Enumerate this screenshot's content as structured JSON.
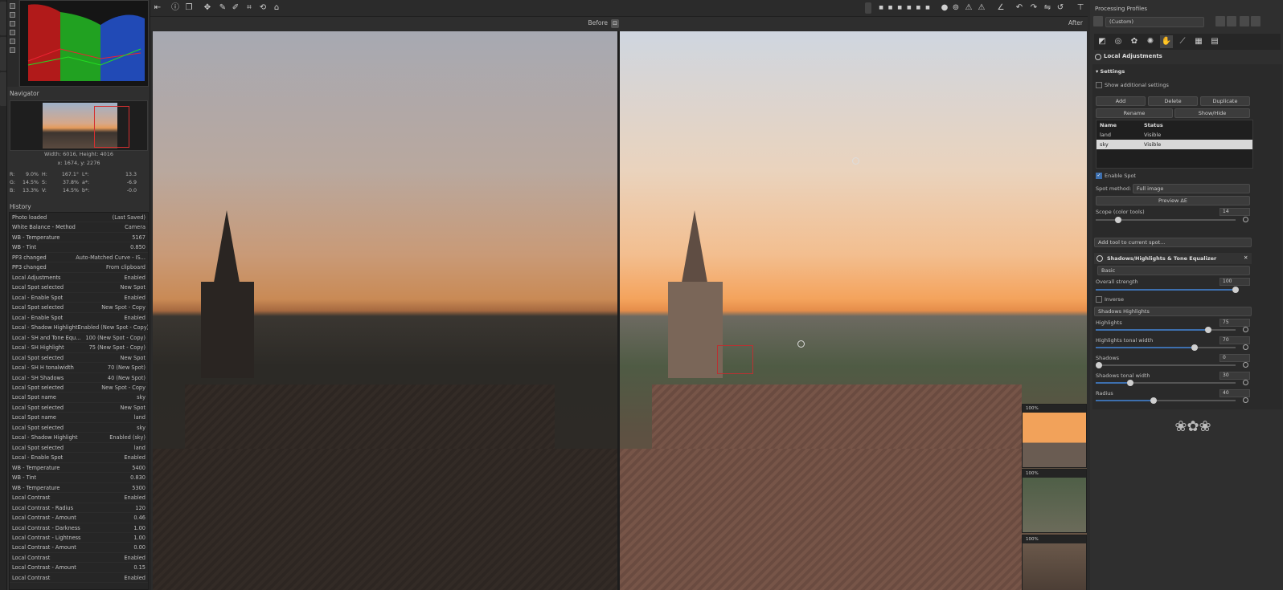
{
  "preview": {
    "before_label": "Before",
    "after_label": "After"
  },
  "detail_windows": [
    "100%",
    "100%",
    "100%"
  ],
  "navigator": {
    "title": "Navigator",
    "size": "Width: 6016, Height: 4016",
    "pos": "x: 1674, y: 2276"
  },
  "info": {
    "rows": [
      [
        "R:",
        "9.0%",
        "H:",
        "167.1°",
        "L*:",
        "13.3"
      ],
      [
        "G:",
        "14.5%",
        "S:",
        "37.8%",
        "a*:",
        "-6.9"
      ],
      [
        "B:",
        "13.3%",
        "V:",
        "14.5%",
        "b*:",
        "-0.0"
      ]
    ]
  },
  "history": {
    "title": "History",
    "items": [
      [
        "Photo loaded",
        "(Last Saved)"
      ],
      [
        "White Balance - Method",
        "Camera"
      ],
      [
        "WB - Temperature",
        "5167"
      ],
      [
        "WB - Tint",
        "0.850"
      ],
      [
        "PP3 changed",
        "Auto-Matched Curve - IS..."
      ],
      [
        "PP3 changed",
        "From clipboard"
      ],
      [
        "Local Adjustments",
        "Enabled"
      ],
      [
        "Local Spot selected",
        "New Spot"
      ],
      [
        "Local - Enable Spot",
        "Enabled"
      ],
      [
        "Local Spot selected",
        "New Spot - Copy"
      ],
      [
        "Local - Enable Spot",
        "Enabled"
      ],
      [
        "Local - Shadow Highlight",
        "Enabled (New Spot - Copy)"
      ],
      [
        "Local - SH and Tone Equ...",
        "100 (New Spot - Copy)"
      ],
      [
        "Local - SH Highlight",
        "75 (New Spot - Copy)"
      ],
      [
        "Local Spot selected",
        "New Spot"
      ],
      [
        "Local - SH H tonalwidth",
        "70 (New Spot)"
      ],
      [
        "Local - SH Shadows",
        "40 (New Spot)"
      ],
      [
        "Local Spot selected",
        "New Spot - Copy"
      ],
      [
        "Local Spot name",
        "sky"
      ],
      [
        "Local Spot selected",
        "New Spot"
      ],
      [
        "Local Spot name",
        "land"
      ],
      [
        "Local Spot selected",
        "sky"
      ],
      [
        "Local - Shadow Highlight",
        "Enabled (sky)"
      ],
      [
        "Local Spot selected",
        "land"
      ],
      [
        "Local - Enable Spot",
        "Enabled"
      ],
      [
        "WB - Temperature",
        "5400"
      ],
      [
        "WB - Tint",
        "0.830"
      ],
      [
        "WB - Temperature",
        "5300"
      ],
      [
        "Local Contrast",
        "Enabled"
      ],
      [
        "Local Contrast - Radius",
        "120"
      ],
      [
        "Local Contrast - Amount",
        "0.46"
      ],
      [
        "Local Contrast - Darkness",
        "1.00"
      ],
      [
        "Local Contrast - Lightness",
        "1.00"
      ],
      [
        "Local Contrast - Amount",
        "0.00"
      ],
      [
        "Local Contrast",
        "Enabled"
      ],
      [
        "Local Contrast - Amount",
        "0.15"
      ],
      [
        "Local Contrast",
        "Enabled"
      ]
    ]
  },
  "right": {
    "profiles_title": "Processing Profiles",
    "profile_value": "(Custom)",
    "local_adj_title": "Local Adjustments",
    "settings_title": "Settings",
    "show_additional": "Show additional settings",
    "buttons": {
      "add": "Add",
      "delete": "Delete",
      "duplicate": "Duplicate",
      "rename": "Rename",
      "showhide": "Show/Hide"
    },
    "table": {
      "h_name": "Name",
      "h_status": "Status",
      "rows": [
        [
          "land",
          "Visible"
        ],
        [
          "sky",
          "Visible"
        ]
      ]
    },
    "enable_spot": "Enable Spot",
    "spot_method_label": "Spot method:",
    "spot_method_value": "Full image",
    "preview_de": "Preview ΔE",
    "scope_label": "Scope (color tools)",
    "scope_value": "14",
    "add_tool": "Add tool to current spot...",
    "sh_title": "Shadows/Highlights & Tone Equalizer",
    "mode": "Basic",
    "overall_label": "Overall strength",
    "overall_value": "100",
    "inverse": "Inverse",
    "sh_method": "Shadows Highlights",
    "sliders": [
      {
        "label": "Highlights",
        "value": "75",
        "frac": 0.8
      },
      {
        "label": "Highlights tonal width",
        "value": "70",
        "frac": 0.7
      },
      {
        "label": "Shadows",
        "value": "0",
        "frac": 0.0
      },
      {
        "label": "Shadows tonal width",
        "value": "30",
        "frac": 0.23
      },
      {
        "label": "Radius",
        "value": "40",
        "frac": 0.4
      }
    ]
  }
}
